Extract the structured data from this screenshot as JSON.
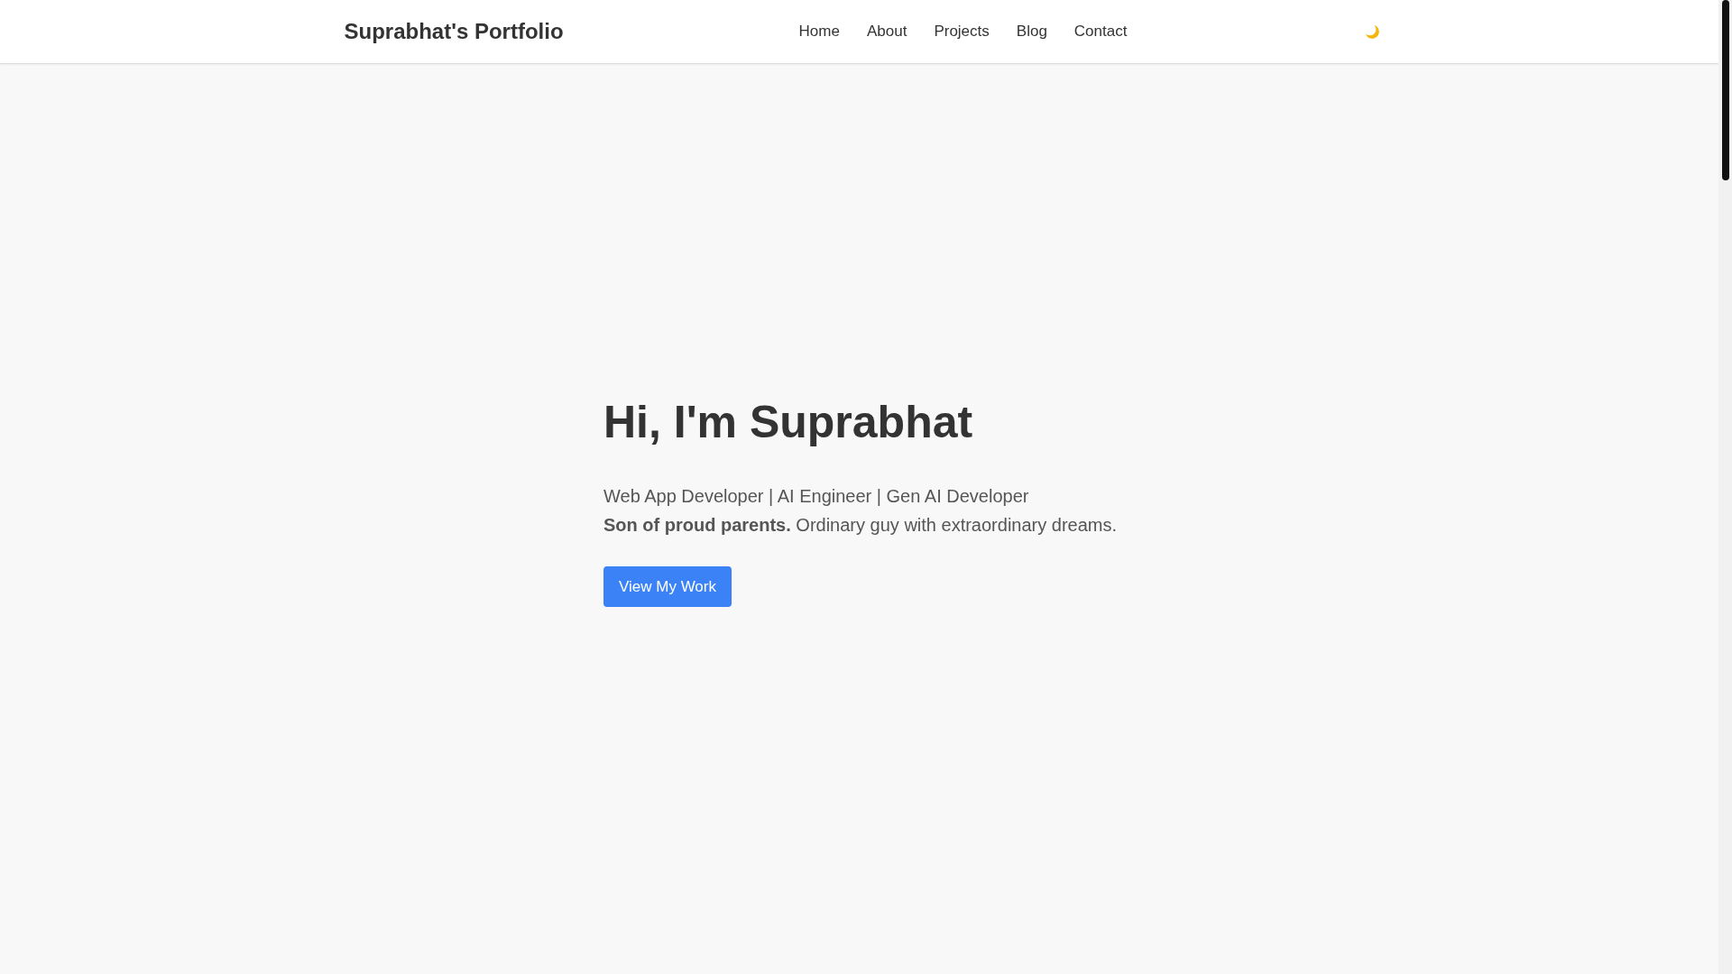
{
  "header": {
    "title": "Suprabhat's Portfolio",
    "nav": [
      {
        "label": "Home"
      },
      {
        "label": "About"
      },
      {
        "label": "Projects"
      },
      {
        "label": "Blog"
      },
      {
        "label": "Contact"
      }
    ]
  },
  "hero": {
    "heading": "Hi, I'm Suprabhat",
    "lines": [
      "Web App Developer | AI Engineer | Gen AI Developer",
      "**Son of proud parents.** Ordinary guy with extraordinary dreams."
    ],
    "button": "View My Work"
  }
}
